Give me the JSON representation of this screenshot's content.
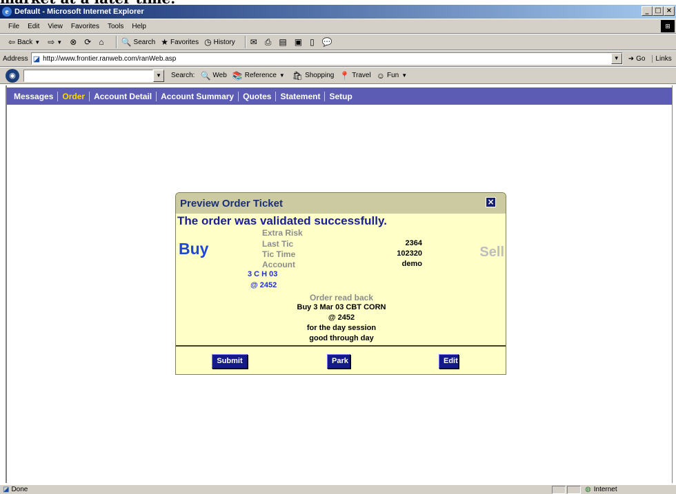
{
  "caption": "market at a later time.",
  "window": {
    "title": "Default - Microsoft Internet Explorer",
    "min": "_",
    "max": "□",
    "close": "×"
  },
  "menubar": {
    "items": [
      "File",
      "Edit",
      "View",
      "Favorites",
      "Tools",
      "Help"
    ]
  },
  "toolbar": {
    "back": "Back",
    "search": "Search",
    "favorites": "Favorites",
    "history": "History"
  },
  "addressbar": {
    "label": "Address",
    "url": "http://www.frontier.ranweb.com/ranWeb.asp",
    "go": "Go",
    "links": "Links"
  },
  "searchbar": {
    "search_label": "Search:",
    "web": "Web",
    "reference": "Reference",
    "shopping": "Shopping",
    "travel": "Travel",
    "fun": "Fun"
  },
  "app_nav": {
    "items": [
      "Messages",
      "Order",
      "Account Detail",
      "Account Summary",
      "Quotes",
      "Statement",
      "Setup"
    ],
    "active": "Order",
    "colors": {
      "bar": "#5c5cb5",
      "active": "#ffd700"
    }
  },
  "dialog": {
    "title": "Preview Order Ticket",
    "close": "×",
    "message": "The order was validated successfully.",
    "buy": "Buy",
    "sell": "Sell",
    "fields": {
      "extra_risk": {
        "label": "Extra Risk",
        "value": ""
      },
      "last_tic": {
        "label": "Last Tic",
        "value": "2364"
      },
      "tic_time": {
        "label": "Tic Time",
        "value": "102320"
      },
      "account": {
        "label": "Account",
        "value": "demo"
      }
    },
    "contract": "3 C H 03",
    "price": "@ 2452",
    "readback": {
      "title": "Order read back",
      "lines": [
        "Buy 3 Mar 03 CBT CORN",
        "@ 2452",
        "for the day session",
        "good through day"
      ]
    },
    "buttons": {
      "submit": "Submit",
      "park": "Park",
      "edit": "Edit"
    }
  },
  "status": {
    "text": "Done",
    "zone": "Internet"
  }
}
